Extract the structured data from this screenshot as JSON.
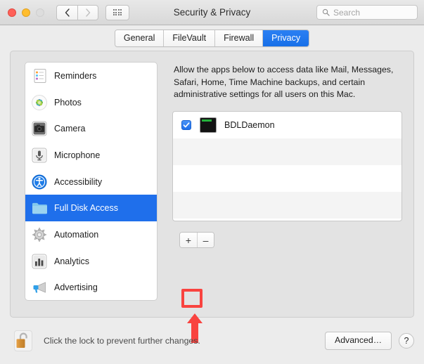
{
  "window": {
    "title": "Security & Privacy",
    "traffic_lights": [
      "close",
      "minimize",
      "zoom-disabled"
    ],
    "nav": {
      "back": "‹",
      "forward": "›",
      "grid": "grid-icon"
    },
    "search": {
      "value": "",
      "placeholder": "Search"
    }
  },
  "tabs": [
    {
      "label": "General",
      "active": false
    },
    {
      "label": "FileVault",
      "active": false
    },
    {
      "label": "Firewall",
      "active": false
    },
    {
      "label": "Privacy",
      "active": true
    }
  ],
  "sidebar": {
    "items": [
      {
        "label": "Reminders",
        "icon": "reminders-icon",
        "selected": false
      },
      {
        "label": "Photos",
        "icon": "photos-icon",
        "selected": false
      },
      {
        "label": "Camera",
        "icon": "camera-icon",
        "selected": false
      },
      {
        "label": "Microphone",
        "icon": "microphone-icon",
        "selected": false
      },
      {
        "label": "Accessibility",
        "icon": "accessibility-icon",
        "selected": false
      },
      {
        "label": "Full Disk Access",
        "icon": "folder-icon",
        "selected": true
      },
      {
        "label": "Automation",
        "icon": "gear-icon",
        "selected": false
      },
      {
        "label": "Analytics",
        "icon": "analytics-icon",
        "selected": false
      },
      {
        "label": "Advertising",
        "icon": "megaphone-icon",
        "selected": false
      }
    ]
  },
  "main": {
    "description": "Allow the apps below to access data like Mail, Messages, Safari, Home, Time Machine backups, and certain administrative settings for all users on this Mac.",
    "app_rows": [
      {
        "name": "BDLDaemon",
        "checked": true,
        "icon": "terminal-icon"
      },
      {
        "name": "",
        "checked": false,
        "icon": ""
      },
      {
        "name": "",
        "checked": false,
        "icon": ""
      },
      {
        "name": "",
        "checked": false,
        "icon": ""
      }
    ],
    "add_button": "+",
    "remove_button": "–"
  },
  "annotation": {
    "highlight_color": "#f9433f",
    "arrow_target": "add-button"
  },
  "footer": {
    "lock_icon": "unlocked-padlock-icon",
    "lock_text": "Click the lock to prevent further changes.",
    "advanced_label": "Advanced…",
    "help_label": "?"
  }
}
